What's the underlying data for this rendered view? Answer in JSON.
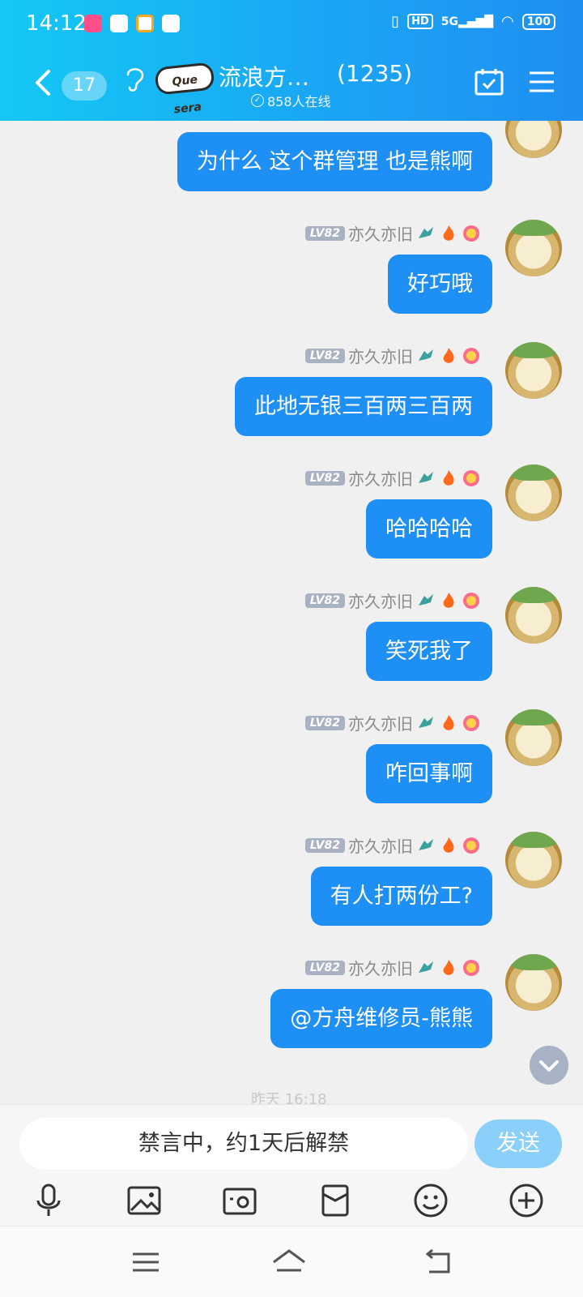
{
  "status_bar": {
    "time": "14:12",
    "hd": "HD",
    "net": "5G",
    "battery": "100"
  },
  "header": {
    "unread_count": "17",
    "logo_text": "Que sera",
    "group_name": "流浪方…",
    "member_count": "(1235)",
    "online_text": "858人在线",
    "accent_color": "#1aa6f4"
  },
  "messages": [
    {
      "text": "为什么 这个群管理 也是熊啊",
      "show_meta": false
    },
    {
      "level": "LV82",
      "sender": "亦久亦旧",
      "text": "好巧哦",
      "show_meta": true
    },
    {
      "level": "LV82",
      "sender": "亦久亦旧",
      "text": "此地无银三百两三百两",
      "show_meta": true
    },
    {
      "level": "LV82",
      "sender": "亦久亦旧",
      "text": "哈哈哈哈",
      "show_meta": true
    },
    {
      "level": "LV82",
      "sender": "亦久亦旧",
      "text": "笑死我了",
      "show_meta": true
    },
    {
      "level": "LV82",
      "sender": "亦久亦旧",
      "text": "咋回事啊",
      "show_meta": true
    },
    {
      "level": "LV82",
      "sender": "亦久亦旧",
      "text": "有人打两份工?",
      "show_meta": true
    },
    {
      "level": "LV82",
      "sender": "亦久亦旧",
      "text": "@方舟维修员-熊熊",
      "show_meta": true
    }
  ],
  "date_separator_peek": "昨天 16:18",
  "input": {
    "muted_text": "禁言中，约1天后解禁",
    "send_label": "发送"
  },
  "toolbar_icons": [
    "microphone-icon",
    "image-icon",
    "camera-icon",
    "red-packet-icon",
    "emoji-icon",
    "plus-icon"
  ],
  "system_nav_icons": [
    "menu-icon",
    "home-icon",
    "back-icon"
  ]
}
